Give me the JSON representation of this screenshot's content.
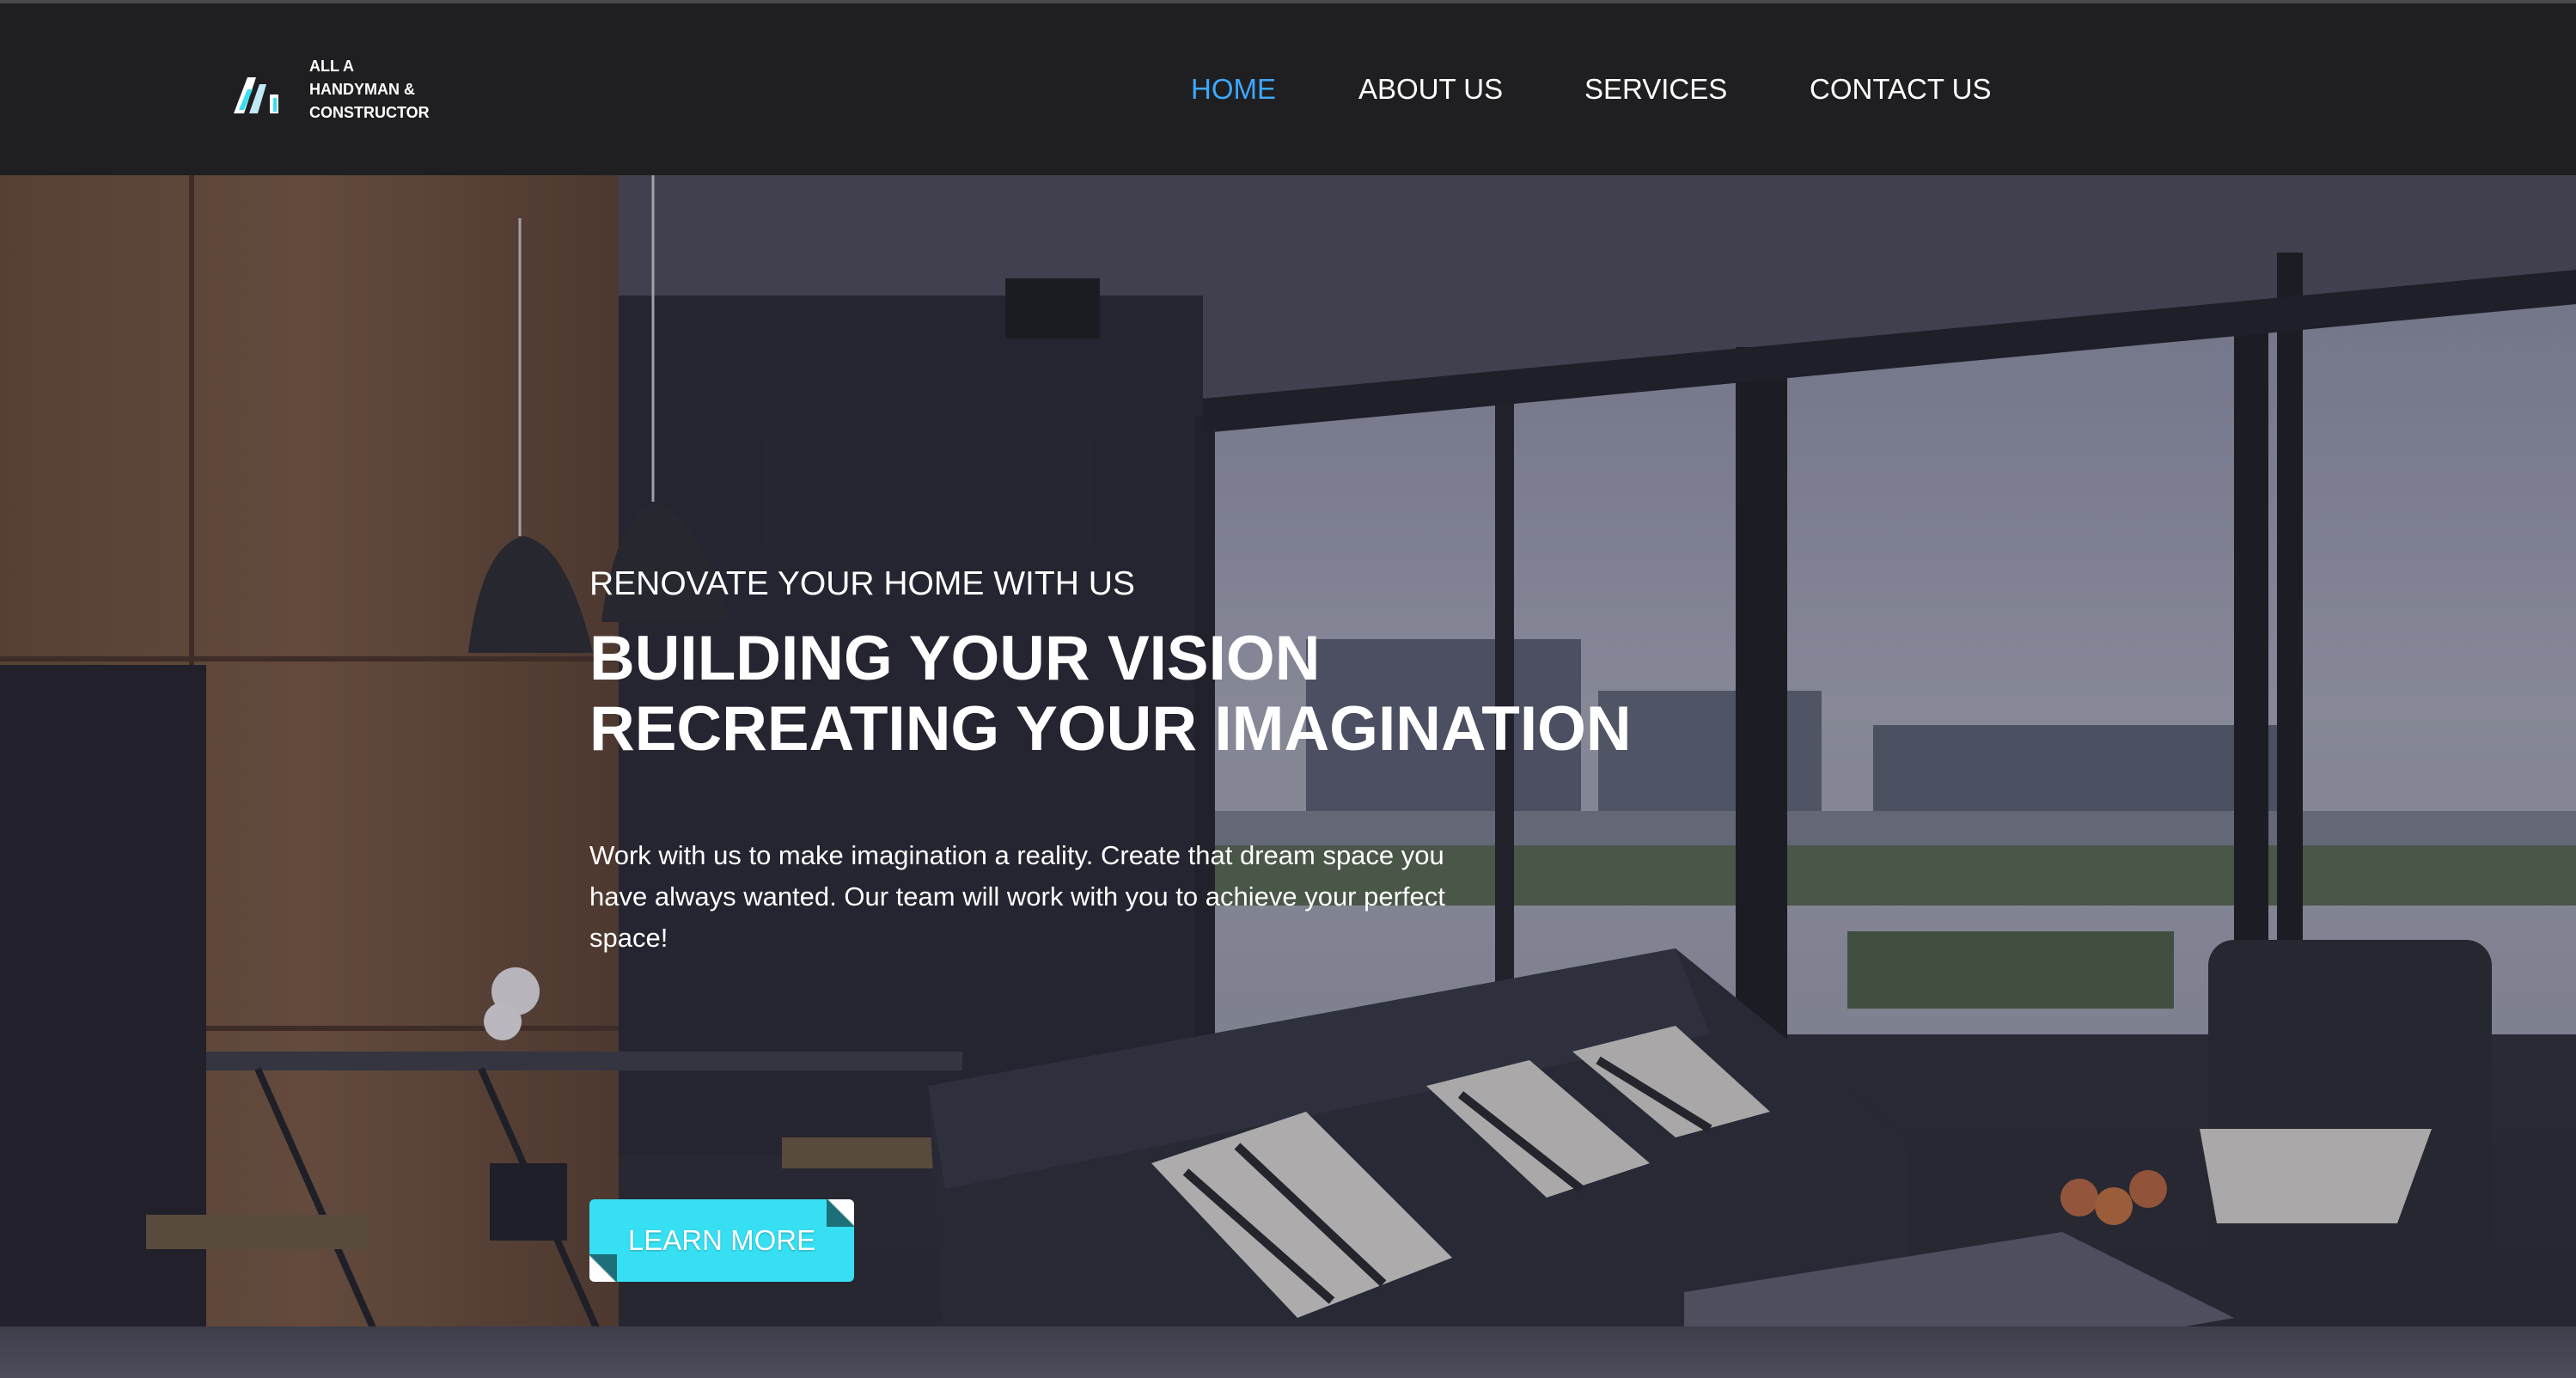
{
  "header": {
    "logo": {
      "lines": [
        "ALL A",
        "HANDYMAN &",
        "CONSTRUCTOR"
      ],
      "icon": "logo-mark-icon"
    },
    "nav": {
      "items": [
        {
          "label": "HOME",
          "active": true
        },
        {
          "label": "ABOUT US",
          "active": false
        },
        {
          "label": "SERVICES",
          "active": false
        },
        {
          "label": "CONTACT US",
          "active": false
        }
      ]
    }
  },
  "hero": {
    "subtitle": "RENOVATE YOUR HOME WITH US",
    "title_lines": [
      "BUILDING YOUR VISION",
      "RECREATING YOUR IMAGINATION"
    ],
    "description": "Work with us to make imagination a reality. Create that dream space you have always wanted. Our team will work with you to achieve your perfect space!",
    "cta_label": "LEARN MORE",
    "background_image": "modern living room interior with leather sofa, patterned cushions, pendant lamps and floor-to-ceiling windows"
  },
  "colors": {
    "header_bg": "#1f1f21",
    "nav_active": "#3ea7ff",
    "nav_text": "#ffffff",
    "cta_bg": "#37dff3"
  }
}
